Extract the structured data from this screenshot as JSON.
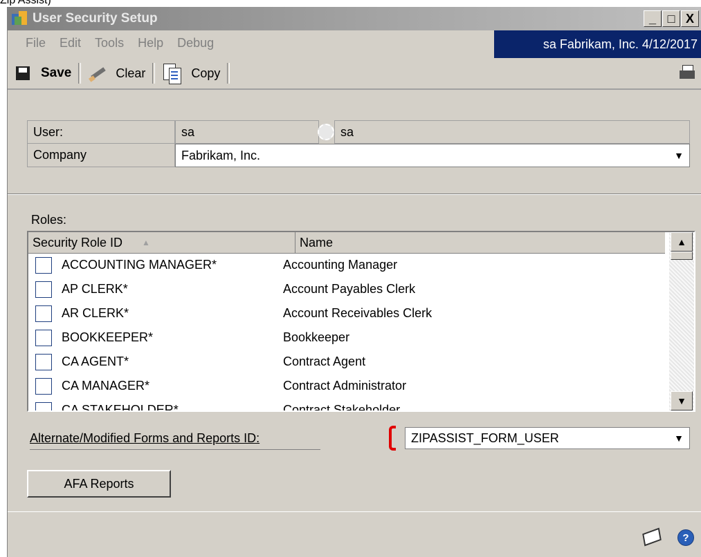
{
  "top_text": "Zip Assist)",
  "window": {
    "title": "User Security Setup",
    "controls": {
      "minimize": "_",
      "maximize": "□",
      "close": "X"
    }
  },
  "menu": {
    "items": [
      "File",
      "Edit",
      "Tools",
      "Help",
      "Debug"
    ],
    "status": "sa  Fabrikam, Inc.  4/12/2017"
  },
  "toolbar": {
    "save_label": "Save",
    "clear_label": "Clear",
    "copy_label": "Copy"
  },
  "form": {
    "user_label": "User:",
    "user_id": "sa",
    "user_name": "sa",
    "company_label": "Company",
    "company_value": "Fabrikam, Inc."
  },
  "roles": {
    "label": "Roles:",
    "columns": [
      "Security Role ID",
      "Name"
    ],
    "sort_indicator": "▲",
    "rows": [
      {
        "id": "ACCOUNTING MANAGER*",
        "name": "Accounting Manager"
      },
      {
        "id": "AP CLERK*",
        "name": "Account Payables Clerk"
      },
      {
        "id": "AR CLERK*",
        "name": "Account Receivables Clerk"
      },
      {
        "id": "BOOKKEEPER*",
        "name": "Bookkeeper"
      },
      {
        "id": "CA AGENT*",
        "name": "Contract Agent"
      },
      {
        "id": "CA MANAGER*",
        "name": "Contract Administrator"
      },
      {
        "id": "CA STAKEHOLDER*",
        "name": "Contract Stakeholder"
      }
    ]
  },
  "alt_forms": {
    "label": "Alternate/Modified Forms and Reports ID:",
    "value": "ZIPASSIST_FORM_USER"
  },
  "afa_button": "AFA Reports",
  "colors": {
    "status_bg": "#0a246a",
    "window_bg": "#d4d0c8",
    "highlight_bracket": "#e00000",
    "help_icon": "#2a5fb8"
  }
}
